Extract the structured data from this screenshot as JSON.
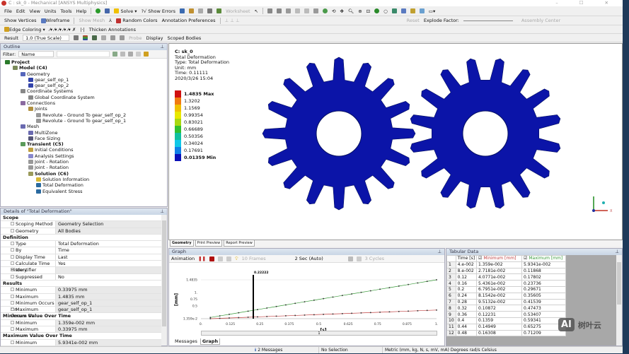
{
  "window": {
    "title": "C : sk_0 - Mechanical [ANSYS Multiphysics]",
    "controls": "– ☐ ✕"
  },
  "menu": [
    "File",
    "Edit",
    "View",
    "Units",
    "Tools",
    "Help"
  ],
  "toolbar1": {
    "solve": "Solve",
    "show_errors": "?√ Show Errors",
    "worksheet": "Worksheet"
  },
  "toolbar2": {
    "show_vertices": "Show Vertices",
    "wireframe": "Wireframe",
    "show_mesh": "Show Mesh",
    "random_colors": "Random Colors",
    "annotation_preferences": "Annotation Preferences",
    "reset": "Reset",
    "explode_factor": "Explode Factor:",
    "assembly_center": "Assembly Center"
  },
  "toolbar3": {
    "edge_coloring": "Edge Coloring",
    "thicken_annotations": "Thicken Annotations"
  },
  "toolbar4": {
    "result_label": "Result",
    "result_scale": "1.0 (True Scale)",
    "probe": "Probe",
    "display_label": "Display",
    "display_value": "Scoped Bodies"
  },
  "outline": {
    "title": "Outline",
    "filter_label": "Filter:",
    "filter_value": "Name",
    "items": [
      {
        "label": "Project",
        "level": 0,
        "bold": true,
        "color": "#2a7a2a"
      },
      {
        "label": "Model (C4)",
        "level": 1,
        "bold": true,
        "color": "#7a8a5a"
      },
      {
        "label": "Geometry",
        "level": 2,
        "color": "#5566bb"
      },
      {
        "label": "gear_self_op_1",
        "level": 3,
        "color": "#3344aa"
      },
      {
        "label": "gear_self_op_2",
        "level": 3,
        "color": "#3344aa"
      },
      {
        "label": "Coordinate Systems",
        "level": 2,
        "color": "#888"
      },
      {
        "label": "Global Coordinate System",
        "level": 3,
        "color": "#888"
      },
      {
        "label": "Connections",
        "level": 2,
        "color": "#8a6aa0"
      },
      {
        "label": "Joints",
        "level": 3,
        "color": "#b09040"
      },
      {
        "label": "Revolute - Ground To gear_self_op_2",
        "level": 4,
        "color": "#999"
      },
      {
        "label": "Revolute - Ground To gear_self_op_1",
        "level": 4,
        "color": "#999"
      },
      {
        "label": "Mesh",
        "level": 2,
        "color": "#6a6ab0"
      },
      {
        "label": "MultiZone",
        "level": 3,
        "color": "#6a6ab0"
      },
      {
        "label": "Face Sizing",
        "level": 3,
        "color": "#557"
      },
      {
        "label": "Transient (C5)",
        "level": 2,
        "bold": true,
        "color": "#5a9a5a"
      },
      {
        "label": "Initial Conditions",
        "level": 3,
        "color": "#c0a040"
      },
      {
        "label": "Analysis Settings",
        "level": 3,
        "color": "#8888cc"
      },
      {
        "label": "Joint - Rotation",
        "level": 3,
        "color": "#999"
      },
      {
        "label": "Joint - Rotation",
        "level": 3,
        "color": "#999"
      },
      {
        "label": "Solution (C6)",
        "level": 3,
        "bold": true,
        "color": "#9a9a5a"
      },
      {
        "label": "Solution Information",
        "level": 4,
        "color": "#d8b830"
      },
      {
        "label": "Total Deformation",
        "level": 4,
        "color": "#2a6aa0"
      },
      {
        "label": "Equivalent Stress",
        "level": 4,
        "color": "#2a6aa0"
      }
    ]
  },
  "details": {
    "title": "Details of \"Total Deformation\"",
    "rows": [
      {
        "section": "Scope"
      },
      {
        "k": "Scoping Method",
        "v": "Geometry Selection"
      },
      {
        "k": "Geometry",
        "v": "All Bodies"
      },
      {
        "section": "Definition"
      },
      {
        "k": "Type",
        "v": "Total Deformation",
        "white": true
      },
      {
        "k": "By",
        "v": "Time",
        "white": true
      },
      {
        "k": "Display Time",
        "v": "Last",
        "white": true,
        "check": true
      },
      {
        "k": "Calculate Time History",
        "v": "Yes",
        "white": true
      },
      {
        "k": "Identifier",
        "v": ""
      },
      {
        "k": "Suppressed",
        "v": "No",
        "white": true
      },
      {
        "section": "Results"
      },
      {
        "k": "Minimum",
        "v": "0.33975 mm",
        "check": true
      },
      {
        "k": "Maximum",
        "v": "1.4835 mm",
        "check": true
      },
      {
        "k": "Minimum Occurs On",
        "v": "gear_self_op_1"
      },
      {
        "k": "Maximum Occurs On",
        "v": "gear_self_op_1"
      },
      {
        "section": "Minimum Value Over Time"
      },
      {
        "k": "Minimum",
        "v": "1.359e-002 mm",
        "check": true
      },
      {
        "k": "Maximum",
        "v": "0.33975 mm",
        "check": true
      },
      {
        "section": "Maximum Value Over Time"
      },
      {
        "k": "Minimum",
        "v": "5.9341e-002 mm",
        "check": true
      }
    ]
  },
  "viewport": {
    "info": [
      "C: sk_0",
      "Total Deformation",
      "Type: Total Deformation",
      "Unit: mm",
      "Time: 0.11111",
      "2020/3/26 15:04"
    ],
    "legend": [
      {
        "label": "1.4835 Max",
        "color": "#d01010",
        "bold": true
      },
      {
        "label": "1.3202",
        "color": "#f07a10"
      },
      {
        "label": "1.1569",
        "color": "#f0c000"
      },
      {
        "label": "0.99354",
        "color": "#e8e800"
      },
      {
        "label": "0.83021",
        "color": "#a8d810"
      },
      {
        "label": "0.66689",
        "color": "#30c030"
      },
      {
        "label": "0.50356",
        "color": "#10c0a0"
      },
      {
        "label": "0.34024",
        "color": "#10c8e8"
      },
      {
        "label": "0.17691",
        "color": "#1080e8"
      },
      {
        "label": "0.01359 Min",
        "color": "#0a10b8",
        "bold": true
      }
    ],
    "gear_color": "#0b14a8",
    "axis_x_label": "X",
    "tabs": [
      "Geometry",
      "Print Preview",
      "Report Preview"
    ]
  },
  "graph": {
    "title": "Graph",
    "animation_label": "Animation",
    "frames": "10 Frames",
    "duration": "2 Sec (Auto)",
    "cycles": "3 Cycles",
    "timeline_label": "1",
    "tabs": [
      "Messages",
      "Graph"
    ]
  },
  "chart_data": {
    "type": "line",
    "xlabel": "[s]",
    "ylabel": "[mm]",
    "xlim": [
      0,
      1
    ],
    "ylim": [
      0.01359,
      1.4835
    ],
    "x_ticks": [
      "0.",
      "0.125",
      "0.25",
      "0.375",
      "0.5",
      "0.625",
      "0.75",
      "0.875",
      "1."
    ],
    "y_ticks": [
      "1.359e-2",
      "0.5",
      "0.75",
      "1.",
      "1.4835"
    ],
    "cursor": {
      "x": 0.22222,
      "label": "0.22222"
    },
    "x": [
      0.04,
      0.08,
      0.12,
      0.16,
      0.2,
      0.24,
      0.28,
      0.32,
      0.36,
      0.4,
      0.44,
      0.48,
      0.52,
      0.56,
      0.6,
      0.64,
      0.68,
      0.72,
      0.76,
      0.8,
      0.84,
      0.88,
      0.92,
      0.96,
      1.0
    ],
    "series": [
      {
        "name": "Minimum [mm]",
        "color": "#c04040",
        "values": [
          0.01359,
          0.027181,
          0.040771,
          0.054361,
          0.067951,
          0.081542,
          0.095132,
          0.10872,
          0.12231,
          0.1359,
          0.14949,
          0.16308,
          0.17667,
          0.19026,
          0.20385,
          0.21744,
          0.23103,
          0.24462,
          0.25821,
          0.2718,
          0.28539,
          0.29898,
          0.31257,
          0.32616,
          0.33975
        ]
      },
      {
        "name": "Maximum [mm]",
        "color": "#3a9a3a",
        "values": [
          0.059341,
          0.11868,
          0.17802,
          0.23736,
          0.29671,
          0.35605,
          0.41539,
          0.47473,
          0.53407,
          0.59341,
          0.65275,
          0.71209,
          0.77143,
          0.83077,
          0.89011,
          0.94945,
          1.0088,
          1.0681,
          1.1275,
          1.1868,
          1.2462,
          1.3055,
          1.3648,
          1.4242,
          1.4835
        ]
      }
    ]
  },
  "tabular": {
    "title": "Tabular Data",
    "columns": [
      "",
      "Time [s]",
      "Minimum [mm]",
      "Maximum [mm]"
    ],
    "rows": [
      [
        "1",
        "4.e-002",
        "1.359e-002",
        "5.9341e-002"
      ],
      [
        "2",
        "8.e-002",
        "2.7181e-002",
        "0.11868"
      ],
      [
        "3",
        "0.12",
        "4.0771e-002",
        "0.17802"
      ],
      [
        "4",
        "0.16",
        "5.4361e-002",
        "0.23736"
      ],
      [
        "5",
        "0.2",
        "6.7951e-002",
        "0.29671"
      ],
      [
        "6",
        "0.24",
        "8.1542e-002",
        "0.35605"
      ],
      [
        "7",
        "0.28",
        "9.5132e-002",
        "0.41539"
      ],
      [
        "8",
        "0.32",
        "0.10872",
        "0.47473"
      ],
      [
        "9",
        "0.36",
        "0.12231",
        "0.53407"
      ],
      [
        "10",
        "0.4",
        "0.1359",
        "0.59341"
      ],
      [
        "11",
        "0.44",
        "0.14949",
        "0.65275"
      ],
      [
        "12",
        "0.48",
        "0.16308",
        "0.71209"
      ]
    ]
  },
  "watermark": {
    "text": "AI 树叶云"
  },
  "status": {
    "messages": "2 Messages",
    "selection": "No Selection",
    "units": "Metric (mm, kg, N, s, mV, mA)  Degrees  rad/s  Celsius"
  }
}
